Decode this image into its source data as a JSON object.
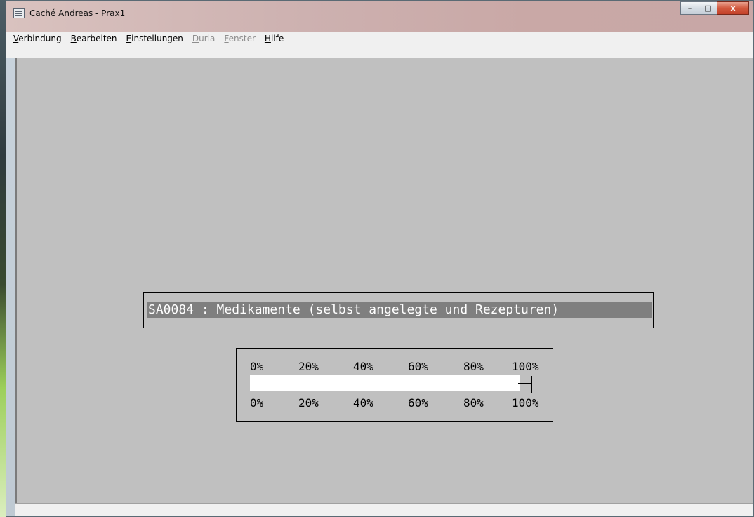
{
  "window": {
    "title": "Caché Andreas - Prax1",
    "buttons": {
      "minimize": "–",
      "maximize": "□",
      "close": "x"
    }
  },
  "menu": {
    "items": [
      {
        "label": "Verbindung",
        "accel": "V",
        "rest": "erbindung",
        "enabled": true
      },
      {
        "label": "Bearbeiten",
        "accel": "B",
        "rest": "earbeiten",
        "enabled": true
      },
      {
        "label": "Einstellungen",
        "accel": "E",
        "rest": "instellungen",
        "enabled": true
      },
      {
        "label": "Duria",
        "accel": "D",
        "rest": "uria",
        "enabled": false
      },
      {
        "label": "Fenster",
        "accel": "F",
        "rest": "enster",
        "enabled": false
      },
      {
        "label": "Hilfe",
        "accel": "H",
        "rest": "ilfe",
        "enabled": true
      }
    ]
  },
  "terminal": {
    "heading": "SA0084 : Medikamente (selbst angelegte und Rezepturen)",
    "progress": {
      "scale_top": [
        "0%",
        "20%",
        "40%",
        "60%",
        "80%",
        "100%"
      ],
      "scale_bottom": [
        "0%",
        "20%",
        "40%",
        "60%",
        "80%",
        "100%"
      ],
      "fraction": 1.0
    }
  }
}
